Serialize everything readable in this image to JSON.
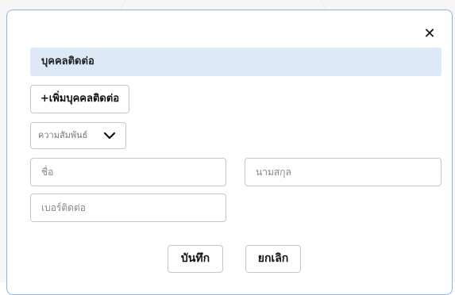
{
  "modal": {
    "close_icon": "close-icon",
    "section_title": "บุคคลติดต่อ",
    "add_contact_label": "+เพิ่มบุคคลติดต่อ",
    "relationship_select": {
      "placeholder": "ความสัมพันธ์",
      "icon": "chevron-down-icon"
    },
    "fields": {
      "first_name_placeholder": "ชื่อ",
      "last_name_placeholder": "นามสกุล",
      "phone_placeholder": "เบอร์ติดต่อ"
    },
    "save_label": "บันทึก",
    "cancel_label": "ยกเลิก"
  }
}
